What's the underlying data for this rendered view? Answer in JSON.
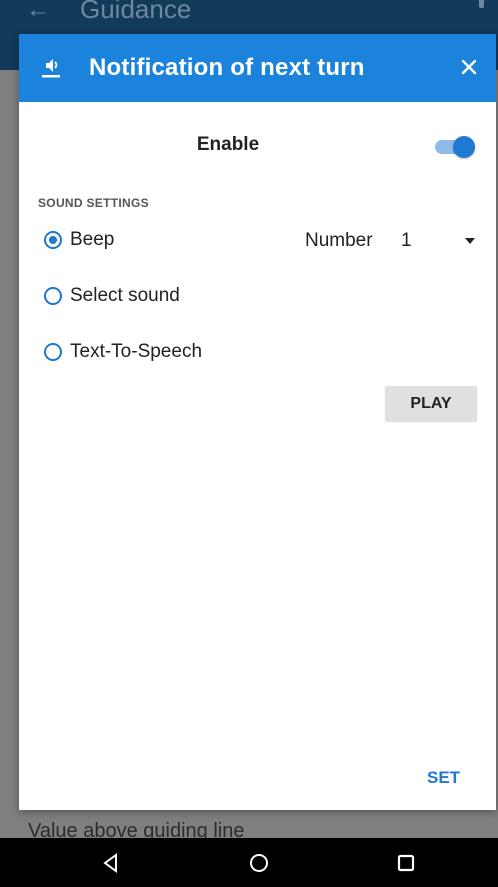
{
  "background": {
    "title": "Guidance",
    "bottom_text": "Value above guiding line"
  },
  "dialog": {
    "title": "Notification of next turn",
    "header_icon": "notification-sound-icon",
    "close_icon": "close-icon",
    "enable": {
      "label": "Enable",
      "on": true
    },
    "sound_settings": {
      "header": "SOUND SETTINGS",
      "options": [
        {
          "label": "Beep",
          "selected": true
        },
        {
          "label": "Select sound",
          "selected": false
        },
        {
          "label": "Text-To-Speech",
          "selected": false
        }
      ],
      "number_label": "Number",
      "number_value": "1"
    },
    "play_label": "PLAY",
    "set_label": "SET"
  },
  "navbar": {
    "back_icon": "back-triangle-icon",
    "home_icon": "home-circle-icon",
    "recents_icon": "recents-square-icon"
  },
  "colors": {
    "accent": "#1c83dc",
    "toggle_thumb": "#1f78d1",
    "toggle_track": "#8fbbe8"
  }
}
